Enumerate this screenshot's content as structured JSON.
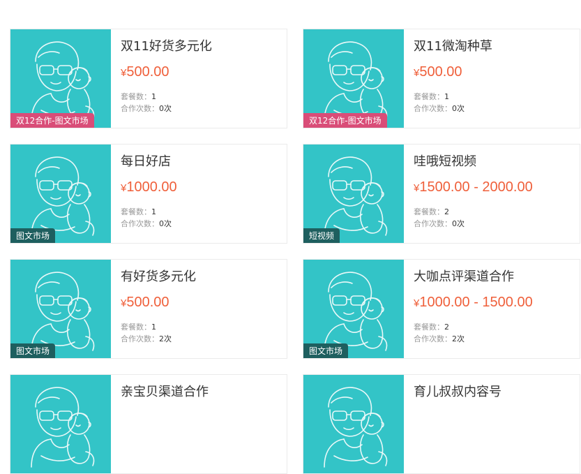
{
  "colors": {
    "accent": "#ef5f3a",
    "thumb_bg": "#33c4c7",
    "tag_pink": "#d94d78",
    "tag_dark": "#1e5f5f"
  },
  "labels": {
    "currency": "¥",
    "packages": "套餐数：",
    "cooperations": "合作次数："
  },
  "cards": [
    {
      "title": "双11好货多元化",
      "price": "500.00",
      "packages": "1",
      "cooperations": "0次",
      "tag": "双12合作-图文市场",
      "tag_color": "#d94d78"
    },
    {
      "title": "双11微淘种草",
      "price": "500.00",
      "packages": "1",
      "cooperations": "0次",
      "tag": "双12合作-图文市场",
      "tag_color": "#d94d78"
    },
    {
      "title": "每日好店",
      "price": "1000.00",
      "packages": "1",
      "cooperations": "0次",
      "tag": "图文市场",
      "tag_color": "#1e5f5f"
    },
    {
      "title": "哇哦短视频",
      "price": "1500.00 - 2000.00",
      "packages": "2",
      "cooperations": "0次",
      "tag": "短视频",
      "tag_color": "#1e5f5f"
    },
    {
      "title": "有好货多元化",
      "price": "500.00",
      "packages": "1",
      "cooperations": "2次",
      "tag": "图文市场",
      "tag_color": "#1e5f5f"
    },
    {
      "title": "大咖点评渠道合作",
      "price": "1000.00 - 1500.00",
      "packages": "2",
      "cooperations": "2次",
      "tag": "图文市场",
      "tag_color": "#1e5f5f"
    },
    {
      "title": "亲宝贝渠道合作",
      "price": "",
      "packages": "",
      "cooperations": "",
      "tag": "",
      "tag_color": "#1e5f5f"
    },
    {
      "title": "育儿叔叔内容号",
      "price": "",
      "packages": "",
      "cooperations": "",
      "tag": "",
      "tag_color": "#1e5f5f"
    }
  ]
}
